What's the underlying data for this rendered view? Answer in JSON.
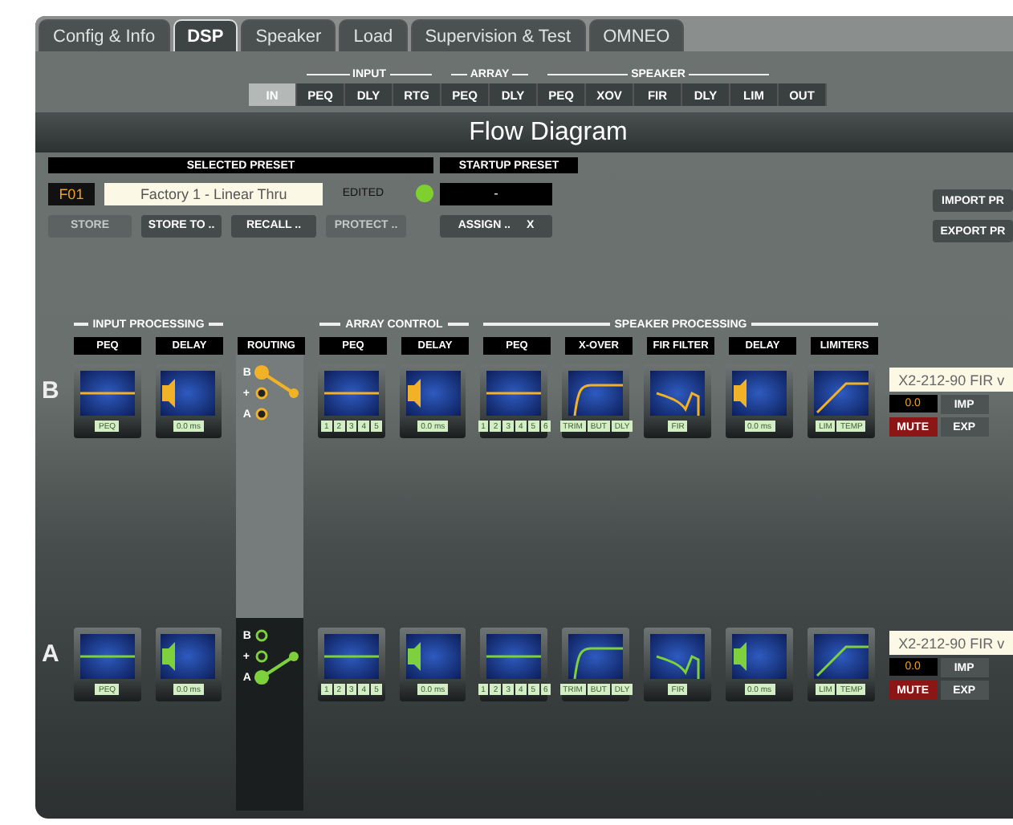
{
  "tabs": [
    {
      "label": "Config & Info",
      "selected": false
    },
    {
      "label": "DSP",
      "selected": true
    },
    {
      "label": "Speaker",
      "selected": false
    },
    {
      "label": "Load",
      "selected": false
    },
    {
      "label": "Supervision & Test",
      "selected": false
    },
    {
      "label": "OMNEO",
      "selected": false
    }
  ],
  "subnav": [
    {
      "buttons": [
        {
          "label": "IN",
          "selected": true
        }
      ]
    },
    {
      "title": "INPUT",
      "buttons": [
        {
          "label": "PEQ",
          "selected": false
        },
        {
          "label": "DLY",
          "selected": false
        },
        {
          "label": "RTG",
          "selected": false
        }
      ]
    },
    {
      "title": "ARRAY",
      "buttons": [
        {
          "label": "PEQ",
          "selected": false
        },
        {
          "label": "DLY",
          "selected": false
        }
      ]
    },
    {
      "title": "SPEAKER",
      "buttons": [
        {
          "label": "PEQ",
          "selected": false
        },
        {
          "label": "XOV",
          "selected": false
        },
        {
          "label": "FIR",
          "selected": false
        },
        {
          "label": "DLY",
          "selected": false
        },
        {
          "label": "LIM",
          "selected": false
        }
      ]
    },
    {
      "buttons": [
        {
          "label": "OUT",
          "selected": false
        }
      ]
    }
  ],
  "title": "Flow Diagram",
  "selected_preset": {
    "heading": "SELECTED PRESET",
    "number": "F01",
    "name": "Factory 1 - Linear Thru",
    "edited_label": "EDITED",
    "edited": true,
    "buttons": [
      {
        "label": "STORE",
        "disabled": true
      },
      {
        "label": "STORE TO ..",
        "disabled": false
      },
      {
        "label": "RECALL ..",
        "disabled": false
      },
      {
        "label": "PROTECT ..",
        "disabled": true
      }
    ]
  },
  "startup_preset": {
    "heading": "STARTUP PRESET",
    "value": "-",
    "assign": "ASSIGN ..",
    "clear": "X"
  },
  "side_buttons": [
    "IMPORT PR",
    "EXPORT PR"
  ],
  "groups": [
    {
      "title": "INPUT PROCESSING",
      "columns": [
        "PEQ",
        "DELAY"
      ]
    },
    {
      "columns": [
        "ROUTING"
      ]
    },
    {
      "title": "ARRAY CONTROL",
      "columns": [
        "PEQ",
        "DELAY"
      ]
    },
    {
      "title": "SPEAKER PROCESSING",
      "columns": [
        "PEQ",
        "X-OVER",
        "FIR FILTER",
        "DELAY",
        "LIMITERS"
      ]
    }
  ],
  "channels": [
    {
      "name": "B",
      "color": "#f2b227",
      "modules": [
        {
          "kind": "peq",
          "labels": [
            "PEQ"
          ]
        },
        {
          "kind": "delay",
          "labels": [
            "0.0 ms"
          ]
        },
        {
          "kind": "routing",
          "inputs": [
            {
              "label": "B",
              "selected": true
            },
            {
              "label": "+",
              "selected": false
            },
            {
              "label": "A",
              "selected": false
            }
          ]
        },
        {
          "kind": "peq",
          "labels": [
            "1",
            "2",
            "3",
            "4",
            "5"
          ]
        },
        {
          "kind": "delay",
          "labels": [
            "0.0 ms"
          ]
        },
        {
          "kind": "peq",
          "labels": [
            "1",
            "2",
            "3",
            "4",
            "5",
            "6"
          ]
        },
        {
          "kind": "xover",
          "labels": [
            "TRIM",
            "BUT",
            "DLY"
          ]
        },
        {
          "kind": "fir",
          "labels": [
            "FIR"
          ]
        },
        {
          "kind": "delay",
          "labels": [
            "0.0 ms"
          ]
        },
        {
          "kind": "limiter",
          "labels": [
            "LIM",
            "TEMP"
          ]
        }
      ],
      "output": {
        "preset": "X2-212-90 FIR v",
        "gain": "0.0",
        "imp": "IMP",
        "mute": "MUTE",
        "muted": true,
        "exp": "EXP"
      }
    },
    {
      "name": "A",
      "color": "#7ed13c",
      "modules": [
        {
          "kind": "peq",
          "labels": [
            "PEQ"
          ]
        },
        {
          "kind": "delay",
          "labels": [
            "0.0 ms"
          ]
        },
        {
          "kind": "routing",
          "inputs": [
            {
              "label": "B",
              "selected": false
            },
            {
              "label": "+",
              "selected": false
            },
            {
              "label": "A",
              "selected": true
            }
          ]
        },
        {
          "kind": "peq",
          "labels": [
            "1",
            "2",
            "3",
            "4",
            "5"
          ]
        },
        {
          "kind": "delay",
          "labels": [
            "0.0 ms"
          ]
        },
        {
          "kind": "peq",
          "labels": [
            "1",
            "2",
            "3",
            "4",
            "5",
            "6"
          ]
        },
        {
          "kind": "xover",
          "labels": [
            "TRIM",
            "BUT",
            "DLY"
          ]
        },
        {
          "kind": "fir",
          "labels": [
            "FIR"
          ]
        },
        {
          "kind": "delay",
          "labels": [
            "0.0 ms"
          ]
        },
        {
          "kind": "limiter",
          "labels": [
            "LIM",
            "TEMP"
          ]
        }
      ],
      "output": {
        "preset": "X2-212-90 FIR v",
        "gain": "0.0",
        "imp": "IMP",
        "mute": "MUTE",
        "muted": true,
        "exp": "EXP"
      }
    }
  ]
}
